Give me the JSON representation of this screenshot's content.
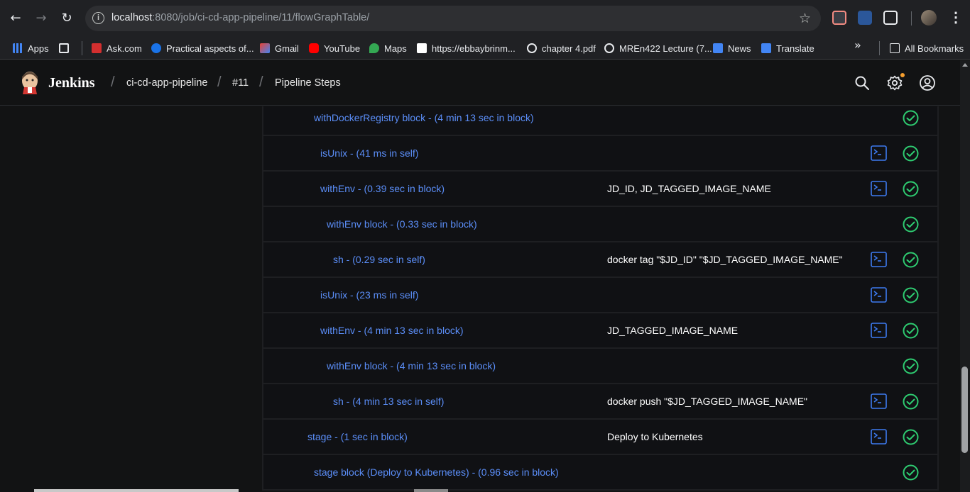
{
  "browser": {
    "url_host": "localhost",
    "url_rest": ":8080/job/ci-cd-app-pipeline/11/flowGraphTable/",
    "bookmarks": [
      {
        "label": "Apps",
        "icon": "apps-grid-icon",
        "color": "#4285f4"
      },
      {
        "label": "",
        "icon": "grid-icon",
        "color": "#e8eaed"
      },
      {
        "label": "Ask.com",
        "icon": "ask-icon",
        "color": "#d32f2f"
      },
      {
        "label": "Practical aspects of...",
        "icon": "c-icon",
        "color": "#1a73e8"
      },
      {
        "label": "Gmail",
        "icon": "gmail-icon",
        "color": "#ea4335"
      },
      {
        "label": "YouTube",
        "icon": "youtube-icon",
        "color": "#ff0000"
      },
      {
        "label": "Maps",
        "icon": "maps-icon",
        "color": "#34a853"
      },
      {
        "label": "https://ebbaybrinm...",
        "icon": "page-icon",
        "color": "#ffffff"
      },
      {
        "label": "chapter 4.pdf",
        "icon": "globe-icon",
        "color": "#e8eaed"
      },
      {
        "label": "MREn422 Lecture (7...",
        "icon": "globe-icon",
        "color": "#e8eaed"
      },
      {
        "label": "News",
        "icon": "news-icon",
        "color": "#4285f4"
      },
      {
        "label": "Translate",
        "icon": "translate-icon",
        "color": "#4285f4"
      }
    ],
    "all_bookmarks": "All Bookmarks"
  },
  "jenkins": {
    "title": "Jenkins",
    "breadcrumbs": [
      "ci-cd-app-pipeline",
      "#11",
      "Pipeline Steps"
    ]
  },
  "steps": [
    {
      "name": "withDockerRegistry block - (4 min 13 sec in block)",
      "args": "",
      "indent": 1,
      "console": false,
      "status": "success"
    },
    {
      "name": "isUnix - (41 ms in self)",
      "args": "",
      "indent": 2,
      "console": true,
      "status": "success"
    },
    {
      "name": "withEnv - (0.39 sec in block)",
      "args": "JD_ID, JD_TAGGED_IMAGE_NAME",
      "indent": 2,
      "console": true,
      "status": "success"
    },
    {
      "name": "withEnv block - (0.33 sec in block)",
      "args": "",
      "indent": 3,
      "console": false,
      "status": "success"
    },
    {
      "name": "sh - (0.29 sec in self)",
      "args": "docker tag \"$JD_ID\" \"$JD_TAGGED_IMAGE_NAME\"",
      "indent": 4,
      "console": true,
      "status": "success"
    },
    {
      "name": "isUnix - (23 ms in self)",
      "args": "",
      "indent": 2,
      "console": true,
      "status": "success"
    },
    {
      "name": "withEnv - (4 min 13 sec in block)",
      "args": "JD_TAGGED_IMAGE_NAME",
      "indent": 2,
      "console": true,
      "status": "success"
    },
    {
      "name": "withEnv block - (4 min 13 sec in block)",
      "args": "",
      "indent": 3,
      "console": false,
      "status": "success"
    },
    {
      "name": "sh - (4 min 13 sec in self)",
      "args": "docker push \"$JD_TAGGED_IMAGE_NAME\"",
      "indent": 4,
      "console": true,
      "status": "success"
    },
    {
      "name": "stage - (1 sec in block)",
      "args": "Deploy to Kubernetes",
      "indent": 0,
      "console": true,
      "status": "success"
    },
    {
      "name": "stage block (Deploy to Kubernetes) - (0.96 sec in block)",
      "args": "",
      "indent": 1,
      "console": false,
      "status": "success"
    }
  ],
  "colors": {
    "link": "#5b8ef8",
    "success": "#2ecc71",
    "console": "#3d7bf0"
  }
}
